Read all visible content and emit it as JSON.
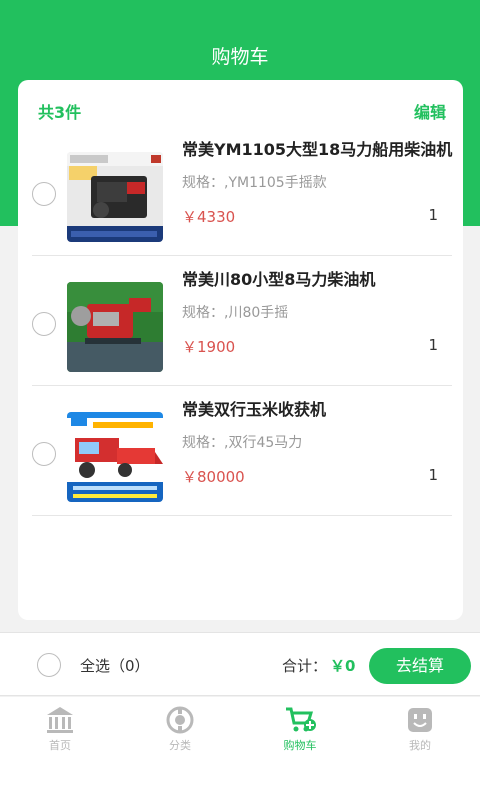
{
  "header": {
    "title": "购物车"
  },
  "cart": {
    "count_label": "共3件",
    "edit_label": "编辑",
    "items": [
      {
        "name": "常美YM1105大型18马力船用柴油机",
        "spec": "规格：,YM1105手摇款",
        "price": "￥4330",
        "qty": "1"
      },
      {
        "name": "常美川80小型8马力柴油机",
        "spec": "规格：,川80手摇",
        "price": "￥1900",
        "qty": "1"
      },
      {
        "name": "常美双行玉米收获机",
        "spec": "规格：,双行45马力",
        "price": "￥80000",
        "qty": "1"
      }
    ]
  },
  "summary": {
    "select_all_label": "全选（0）",
    "total_label": "合计：",
    "total_value": "￥0",
    "checkout_label": "去结算"
  },
  "tabbar": {
    "tabs": [
      {
        "label": "首页",
        "icon": "home-icon"
      },
      {
        "label": "分类",
        "icon": "category-icon"
      },
      {
        "label": "购物车",
        "icon": "cart-icon",
        "active": true
      },
      {
        "label": "我的",
        "icon": "profile-icon"
      }
    ]
  },
  "colors": {
    "brand": "#22c05e",
    "price": "#d9534f",
    "inactive": "#b9b9b9"
  }
}
